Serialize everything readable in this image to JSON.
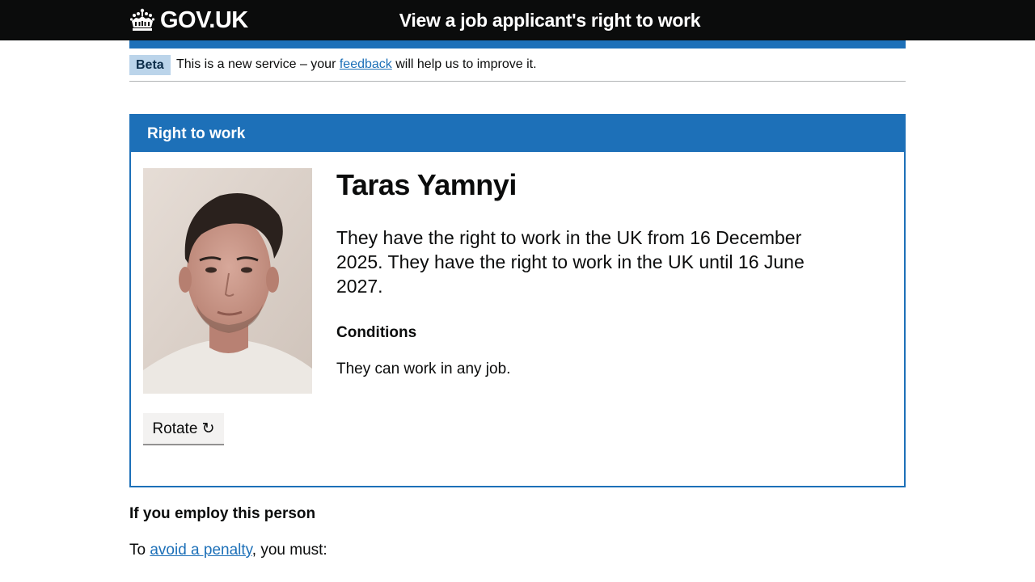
{
  "header": {
    "logo_text": "GOV.UK",
    "service_name": "View a job applicant's right to work"
  },
  "phase_banner": {
    "tag": "Beta",
    "text_before": "This is a new service – your ",
    "link": "feedback",
    "text_after": " will help us to improve it."
  },
  "panel": {
    "title": "Right to work",
    "person_name": "Taras Yamnyi",
    "right_to_work_text": "They have the right to work in the UK from 16 December 2025. They have the right to work in the UK until 16 June 2027.",
    "conditions_heading": "Conditions",
    "conditions_text": "They can work in any job.",
    "rotate_label": "Rotate ↻"
  },
  "employ": {
    "heading": "If you employ this person",
    "penalty_before": "To ",
    "penalty_link": "avoid a penalty",
    "penalty_after": ", you must:"
  },
  "colors": {
    "header_bg": "#0b0c0c",
    "brand_blue": "#1d70b8",
    "tag_bg": "#bbd4ea",
    "button_bg": "#f3f2f1"
  }
}
